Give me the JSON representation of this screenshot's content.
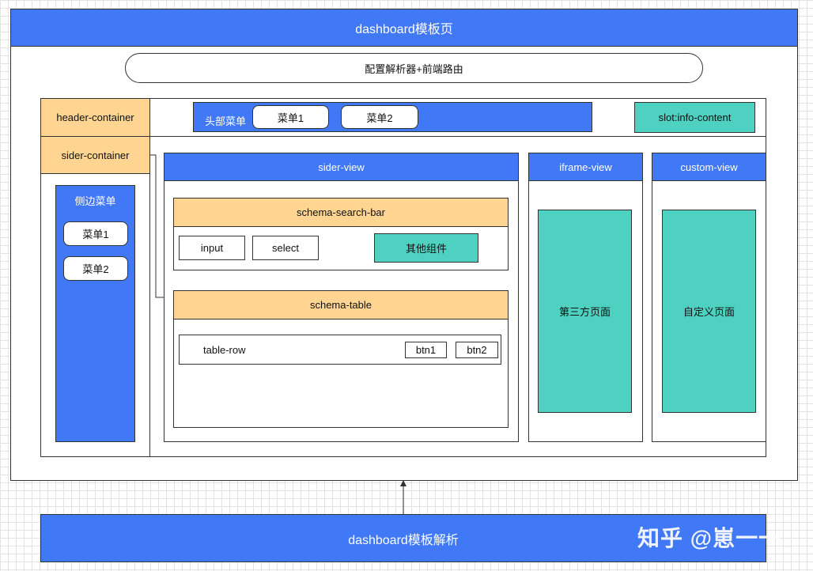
{
  "template_title": "dashboard模板页",
  "config_parser": "配置解析器+前端路由",
  "header_container": "header-container",
  "sider_container": "sider-container",
  "header_menu": {
    "label": "头部菜单",
    "items": [
      "菜单1",
      "菜单2"
    ]
  },
  "slot_info": "slot:info-content",
  "side_menu": {
    "label": "侧边菜单",
    "items": [
      "菜单1",
      "菜单2"
    ]
  },
  "sider_view": {
    "title": "sider-view",
    "search_bar": {
      "title": "schema-search-bar",
      "input": "input",
      "select": "select",
      "other": "其他组件"
    },
    "table": {
      "title": "schema-table",
      "row": "table-row",
      "btn1": "btn1",
      "btn2": "btn2"
    }
  },
  "iframe_view": {
    "title": "iframe-view",
    "content": "第三方页面"
  },
  "custom_view": {
    "title": "custom-view",
    "content": "自定义页面"
  },
  "parser_title": "dashboard模板解析",
  "watermark": "知乎 @崽一一",
  "colors": {
    "blue": "#4078f5",
    "orange": "#ffd591",
    "teal": "#4fd1c1"
  }
}
